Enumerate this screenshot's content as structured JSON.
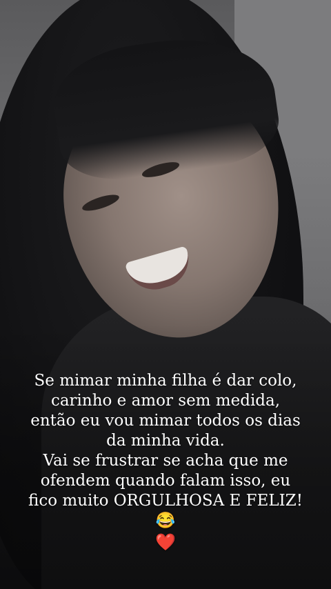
{
  "story": {
    "caption_paragraph_1": "Se mimar minha filha é dar colo, carinho e amor sem medida, então eu vou mimar todos os dias da minha vida.",
    "caption_paragraph_2": "Vai se frustrar se acha que me ofendem quando falam isso, eu fico muito ORGULHOSA E FELIZ!😂",
    "caption_heart": "❤️"
  }
}
